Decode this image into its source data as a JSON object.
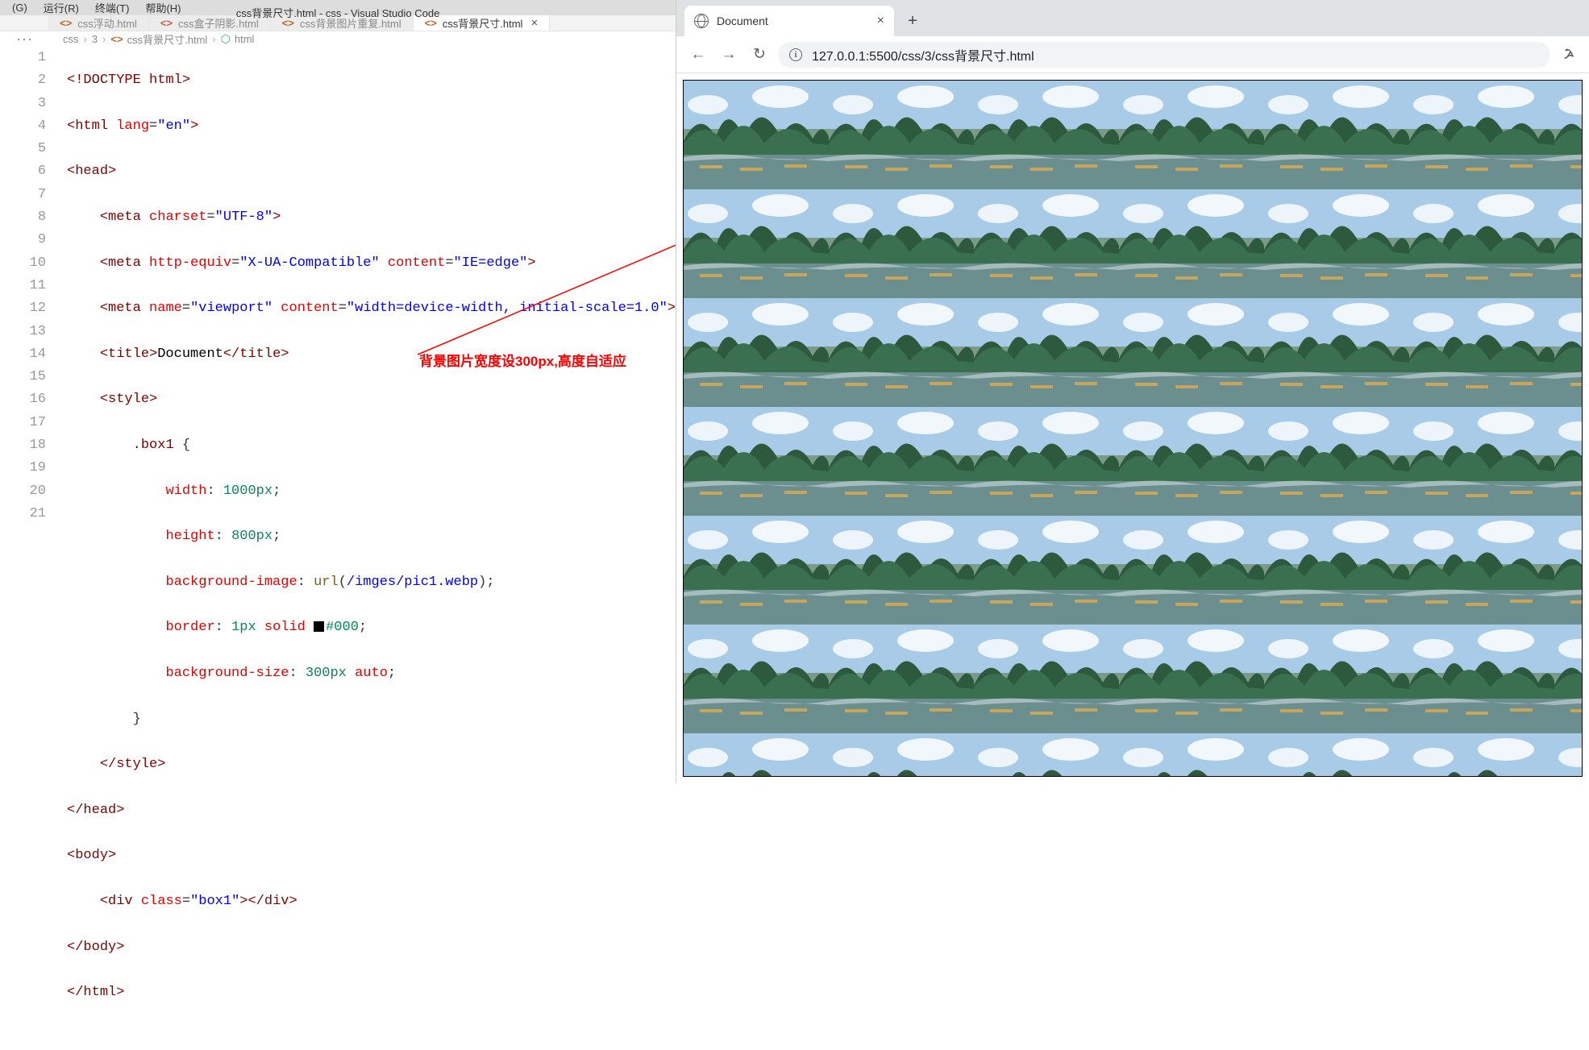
{
  "menu": {
    "g": "(G)",
    "run": "运行(R)",
    "terminal": "终端(T)",
    "help": "帮助(H)"
  },
  "window_title": "css背景尺寸.html - css - Visual Studio Code",
  "tabs": [
    {
      "label": "css浮动.html"
    },
    {
      "label": "css盒子阴影.html"
    },
    {
      "label": "css背景图片重复.html"
    },
    {
      "label": "css背景尺寸.html",
      "active": true
    }
  ],
  "breadcrumb": {
    "p1": "css",
    "p2": "3",
    "p3": "css背景尺寸.html",
    "p4": "html"
  },
  "lines": [
    "1",
    "2",
    "3",
    "4",
    "5",
    "6",
    "7",
    "8",
    "9",
    "10",
    "11",
    "12",
    "13",
    "14",
    "15",
    "16",
    "17",
    "18",
    "19",
    "20",
    "21"
  ],
  "code": {
    "l1": "<!DOCTYPE html>",
    "l2_a": "<html ",
    "l2_b": "lang",
    "l2_c": "=",
    "l2_d": "\"en\"",
    "l2_e": ">",
    "l3": "<head>",
    "l4_a": "    <meta ",
    "l4_b": "charset",
    "l4_c": "=",
    "l4_d": "\"UTF-8\"",
    "l4_e": ">",
    "l5_a": "    <meta ",
    "l5_b": "http-equiv",
    "l5_c": "=",
    "l5_d": "\"X-UA-Compatible\"",
    "l5_e": " ",
    "l5_f": "content",
    "l5_g": "=",
    "l5_h": "\"IE=edge\"",
    "l5_i": ">",
    "l6_a": "    <meta ",
    "l6_b": "name",
    "l6_c": "=",
    "l6_d": "\"viewport\"",
    "l6_e": " ",
    "l6_f": "content",
    "l6_g": "=",
    "l6_h": "\"width=device-width, initial-scale=1.0\"",
    "l6_i": ">",
    "l7_a": "    <title>",
    "l7_b": "Document",
    "l7_c": "</title>",
    "l8": "    <style>",
    "l9_a": "        ",
    "l9_b": ".box1",
    "l9_c": " {",
    "l10_a": "            ",
    "l10_b": "width",
    "l10_c": ": ",
    "l10_d": "1000px",
    "l10_e": ";",
    "l11_a": "            ",
    "l11_b": "height",
    "l11_c": ": ",
    "l11_d": "800px",
    "l11_e": ";",
    "l12_a": "            ",
    "l12_b": "background-image",
    "l12_c": ": ",
    "l12_d": "url",
    "l12_e": "(",
    "l12_f": "/imges/pic1.webp",
    "l12_g": ");",
    "l13_a": "            ",
    "l13_b": "border",
    "l13_c": ": ",
    "l13_d": "1px",
    "l13_e": " ",
    "l13_f": "solid",
    "l13_g": " ",
    "l13_h": "#000",
    "l13_i": ";",
    "l14_a": "            ",
    "l14_b": "background-size",
    "l14_c": ": ",
    "l14_d": "300px",
    "l14_e": " ",
    "l14_f": "auto",
    "l14_g": ";",
    "l15": "        }",
    "l16": "    </style>",
    "l17": "</head>",
    "l18": "<body>",
    "l19_a": "    <div ",
    "l19_b": "class",
    "l19_c": "=",
    "l19_d": "\"box1\"",
    "l19_e": "></div>",
    "l20": "</body>",
    "l21": "</html>"
  },
  "annotation": "背景图片宽度设300px,高度自适应",
  "browser": {
    "tab_title": "Document",
    "url": "127.0.0.1:5500/css/3/css背景尺寸.html"
  }
}
